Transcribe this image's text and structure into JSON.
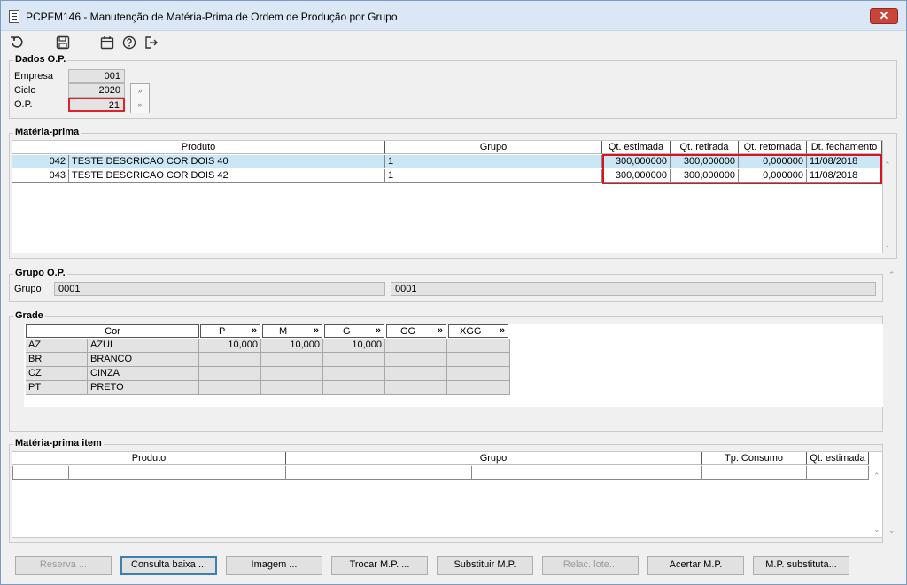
{
  "window": {
    "title": "PCPFM146 - Manutenção de Matéria-Prima de Ordem de Produção por Grupo"
  },
  "toolbar": {
    "icons": [
      "undo-icon",
      "save-icon",
      "calendar-icon",
      "help-icon",
      "exit-icon"
    ]
  },
  "dados_op": {
    "label": "Dados O.P.",
    "empresa_label": "Empresa",
    "empresa": "001",
    "ciclo_label": "Ciclo",
    "ciclo": "2020",
    "op_label": "O.P.",
    "op": "21",
    "lookup_symbol": "»"
  },
  "materia_prima": {
    "label": "Matéria-prima",
    "columns": [
      "Produto",
      "Grupo",
      "Qt. estimada",
      "Qt. retirada",
      "Qt. retornada",
      "Dt. fechamento"
    ],
    "rows": [
      {
        "codigo": "042",
        "produto": "TESTE DESCRICAO COR DOIS 40",
        "grupo": "1",
        "qt_estimada": "300,000000",
        "qt_retirada": "300,000000",
        "qt_retornada": "0,000000",
        "dt_fechamento": "11/08/2018"
      },
      {
        "codigo": "043",
        "produto": "TESTE DESCRICAO COR DOIS 42",
        "grupo": "1",
        "qt_estimada": "300,000000",
        "qt_retirada": "300,000000",
        "qt_retornada": "0,000000",
        "dt_fechamento": "11/08/2018"
      }
    ]
  },
  "grupo_op": {
    "label": "Grupo O.P.",
    "grupo_label": "Grupo",
    "grupo_codigo": "0001",
    "grupo_descricao": "0001"
  },
  "grade": {
    "label": "Grade",
    "cor_header": "Cor",
    "sizes": [
      "P",
      "M",
      "G",
      "GG",
      "XGG"
    ],
    "more_symbol": "»",
    "rows": [
      {
        "codigo": "AZ",
        "cor": "AZUL",
        "values": [
          "10,000",
          "10,000",
          "10,000",
          "",
          ""
        ]
      },
      {
        "codigo": "BR",
        "cor": "BRANCO",
        "values": [
          "",
          "",
          "",
          "",
          ""
        ]
      },
      {
        "codigo": "CZ",
        "cor": "CINZA",
        "values": [
          "",
          "",
          "",
          "",
          ""
        ]
      },
      {
        "codigo": "PT",
        "cor": "PRETO",
        "values": [
          "",
          "",
          "",
          "",
          ""
        ]
      }
    ]
  },
  "materia_prima_item": {
    "label": "Matéria-prima item",
    "columns": [
      "Produto",
      "Grupo",
      "Tp. Consumo",
      "Qt. estimada"
    ]
  },
  "buttons": [
    {
      "label": "Reserva ...",
      "enabled": false
    },
    {
      "label": "Consulta baixa ...",
      "enabled": true
    },
    {
      "label": "Imagem ...",
      "enabled": true
    },
    {
      "label": "Trocar M.P. ...",
      "enabled": true
    },
    {
      "label": "Substituir M.P.",
      "enabled": true
    },
    {
      "label": "Relac. lote...",
      "enabled": false
    },
    {
      "label": "Acertar M.P.",
      "enabled": true
    },
    {
      "label": "M.P. substituta...",
      "enabled": true
    }
  ],
  "colors": {
    "highlight_red": "#e0202a",
    "selected_row": "#cbe6f5",
    "close_button": "#c9453a"
  }
}
